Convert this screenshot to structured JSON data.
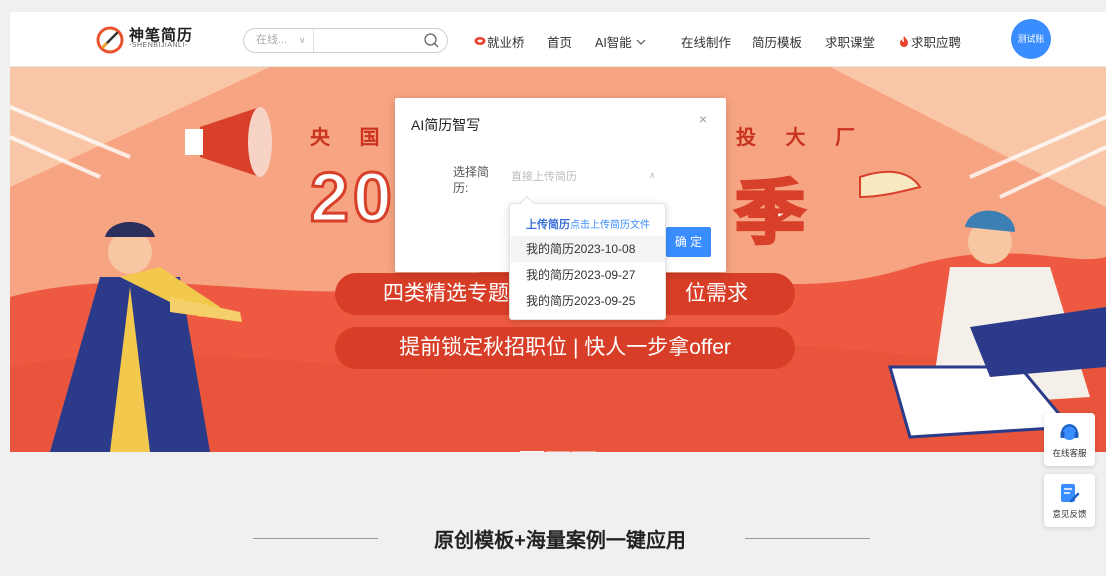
{
  "header": {
    "logo_title": "神笔简历",
    "logo_sub": "-SHENBIJIANLI-",
    "search_select": "在线...",
    "search_placeholder": "",
    "nav": {
      "jiuyeqiao": "就业桥",
      "home": "首页",
      "ai": "AI智能",
      "online_make": "在线制作",
      "templates": "简历模板",
      "courses": "求职课堂",
      "apply": "求职应聘"
    },
    "avatar_label": "测试账"
  },
  "banner": {
    "line1_left": "央 国 企",
    "line1_right": "投 大 厂",
    "big_left": "20",
    "big_right": "季",
    "pill1_left": "四类精选专题",
    "pill1_right": "位需求",
    "pill2": "提前锁定秋招职位 | 快人一步拿offer"
  },
  "modal": {
    "title": "AI简历智写",
    "close": "×",
    "label": "选择简历:",
    "select_placeholder": "直接上传简历",
    "ok_label": "确 定"
  },
  "dropdown": {
    "upload_bold": "上传简历",
    "upload_hint": "点击上传简历文件",
    "items": [
      "我的简历2023-10-08",
      "我的简历2023-09-27",
      "我的简历2023-09-25"
    ],
    "active_index": 0
  },
  "lower": {
    "title": "原创模板+海量案例一键应用"
  },
  "float": {
    "service": "在线客服",
    "feedback": "意见反馈"
  },
  "colors": {
    "accent": "#3a8dff",
    "banner": "#f26e59",
    "pill": "#d83e27"
  }
}
